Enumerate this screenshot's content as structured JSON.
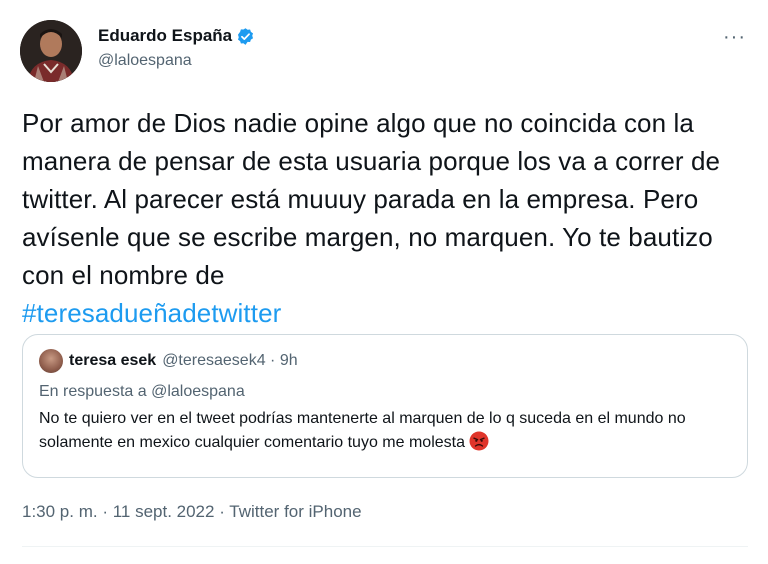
{
  "author": {
    "name": "Eduardo España",
    "handle": "@laloespana",
    "verified": true,
    "avatar_icon": "profile-photo"
  },
  "more_icon": "more-horizontal-icon",
  "more_label": "···",
  "tweet": {
    "text": "Por amor de Dios nadie opine algo que no coincida con la manera de pensar de esta usuaria porque los va a correr de twitter. Al parecer está muuuy parada en la empresa. Pero avísenle que se escribe margen, no marquen. Yo te bautizo con el nombre de",
    "hashtag": "#teresadueñadetwitter"
  },
  "quoted_tweet": {
    "name": "teresa esek",
    "handle_time": "@teresaesek4 · 9h",
    "reply_prefix": "En respuesta a",
    "reply_to": "@laloespana",
    "text": "No te quiero ver en el tweet podrías mantenerte al marquen de lo q suceda en el mundo no solamente en mexico cualquier comentario tuyo me molesta",
    "emoji_icon": "angry-face-icon"
  },
  "meta": {
    "time_date": "1:30 p. m. · 11 sept. 2022 · ",
    "source": "Twitter for iPhone"
  },
  "colors": {
    "link": "#1d9bf0",
    "secondary_text": "#536471",
    "border": "#cfd9de",
    "verified": "#1d9bf0"
  }
}
